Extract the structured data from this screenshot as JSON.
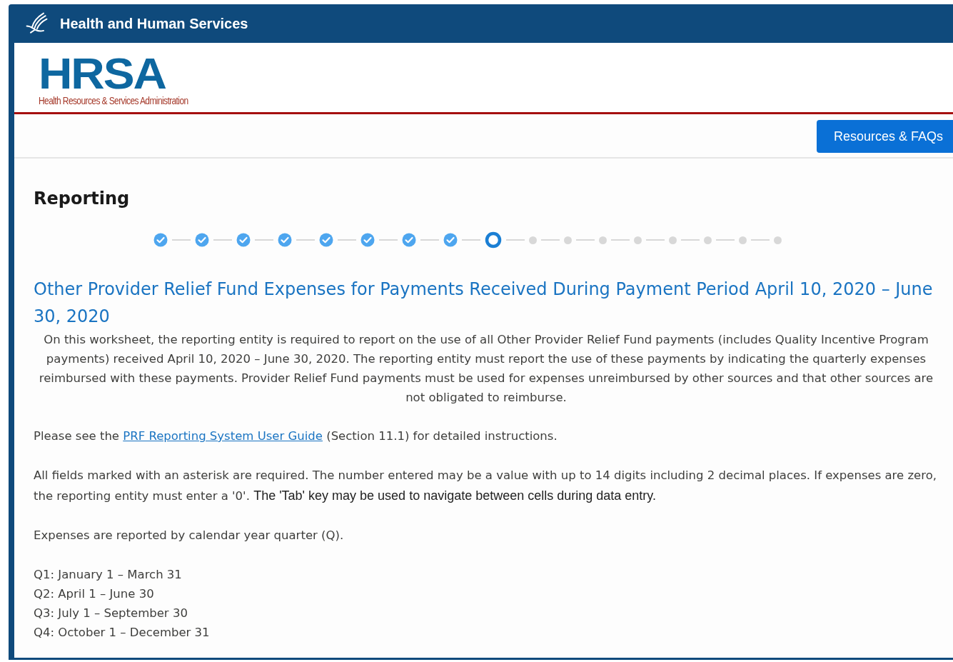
{
  "header": {
    "title": "Health and Human Services"
  },
  "logo": {
    "acronym": "HRSA",
    "full_name": "Health Resources & Services Administration"
  },
  "nav": {
    "button": "Resources & FAQs"
  },
  "page_title": "Reporting",
  "steps": [
    {
      "kind": "done"
    },
    {
      "kind": "done"
    },
    {
      "kind": "done"
    },
    {
      "kind": "done"
    },
    {
      "kind": "done"
    },
    {
      "kind": "done"
    },
    {
      "kind": "done"
    },
    {
      "kind": "done"
    },
    {
      "kind": "current"
    },
    {
      "kind": "todo"
    },
    {
      "kind": "todo"
    },
    {
      "kind": "todo"
    },
    {
      "kind": "todo"
    },
    {
      "kind": "todo"
    },
    {
      "kind": "todo"
    },
    {
      "kind": "todo"
    },
    {
      "kind": "todo"
    }
  ],
  "section_title": "Other Provider Relief Fund Expenses for Payments Received During Payment Period April 10, 2020 – June 30, 2020",
  "intro": "On this worksheet, the reporting entity is required to report on the use of all Other Provider Relief Fund payments (includes Quality Incentive Program payments) received April 10, 2020 – June 30, 2020. The reporting entity must report the use of these payments by indicating the quarterly expenses reimbursed with these payments.  Provider Relief Fund payments must be used for expenses unreimbursed by other sources and that other sources are not obligated to reimburse.",
  "guide": {
    "before": "Please see the",
    "link": "PRF Reporting System User Guide",
    "after": "(Section 11.1) for detailed instructions."
  },
  "required_note": "All fields marked with an asterisk are required. The number entered may be a value with up to 14 digits including 2 decimal places. If expenses are zero, the reporting entity must enter a '0'.",
  "tab_note": "The 'Tab' key may be used to navigate between cells during data entry.",
  "quarters_note": "Expenses are reported by calendar year quarter (Q).",
  "quarters": [
    "Q1: January 1 – March 31",
    "Q2: April 1 – June 30",
    "Q3: July 1 – September 30",
    "Q4: October 1 – December 31"
  ]
}
